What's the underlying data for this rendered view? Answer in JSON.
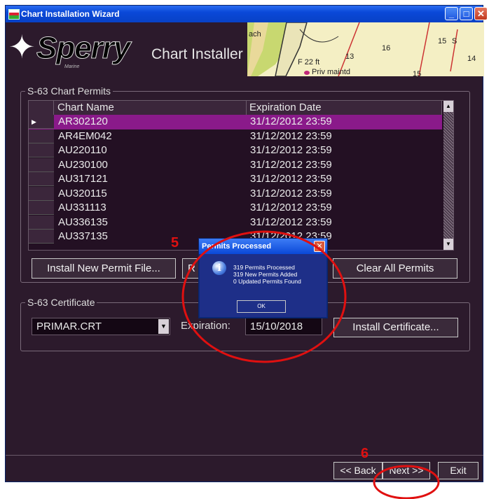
{
  "window": {
    "title": "Chart Installation Wizard",
    "controls": {
      "minimize": "_",
      "maximize": "□",
      "close": "✕"
    }
  },
  "header": {
    "brand": "Sperry",
    "tagline": "Marine",
    "subtitle": "Chart Installer",
    "chart_text": [
      "ach",
      "F 22 ft",
      "Priv maintd",
      "13",
      "16",
      "15",
      "S",
      "14",
      "15"
    ]
  },
  "permits": {
    "group_title": "S-63 Chart Permits",
    "columns": [
      "Chart Name",
      "Expiration Date"
    ],
    "rows": [
      {
        "name": "AR302120",
        "expires": "31/12/2012 23:59"
      },
      {
        "name": "AR4EM042",
        "expires": "31/12/2012 23:59"
      },
      {
        "name": "AU220110",
        "expires": "31/12/2012 23:59"
      },
      {
        "name": "AU230100",
        "expires": "31/12/2012 23:59"
      },
      {
        "name": "AU317121",
        "expires": "31/12/2012 23:59"
      },
      {
        "name": "AU320115",
        "expires": "31/12/2012 23:59"
      },
      {
        "name": "AU331113",
        "expires": "31/12/2012 23:59"
      },
      {
        "name": "AU336135",
        "expires": "31/12/2012 23:59"
      },
      {
        "name": "AU337135",
        "expires": "31/12/2012 23:59"
      }
    ],
    "install_button": "Install New Permit File...",
    "hidden_button_fragment": "R",
    "clear_button": "Clear All Permits"
  },
  "certificate": {
    "group_title": "S-63 Certificate",
    "selected": "PRIMAR.CRT",
    "expiration_label": "Expiration:",
    "expiration_value": "15/10/2018",
    "install_button": "Install Certificate..."
  },
  "footer": {
    "back": "<< Back",
    "next": "Next >>",
    "exit": "Exit"
  },
  "dialog": {
    "title": "Permits Processed",
    "lines": [
      "319 Permits Processed",
      "319 New Permits Added",
      "0 Updated Permits Found"
    ],
    "ok": "OK"
  },
  "annotations": {
    "step5": "5",
    "step6": "6",
    "color": "#e01010"
  }
}
